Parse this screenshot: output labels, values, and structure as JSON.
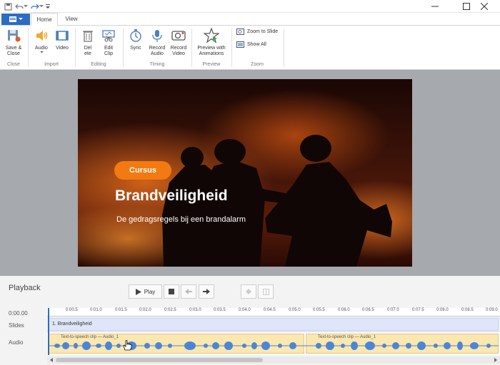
{
  "titlebar": {
    "icons": [
      "save-icon",
      "undo-icon",
      "redo-icon",
      "customize-icon"
    ],
    "controls": [
      "minimize-icon",
      "maximize-icon",
      "close-icon"
    ]
  },
  "ribbon": {
    "tabs": [
      {
        "label": "Home",
        "active": true
      },
      {
        "label": "View",
        "active": false
      }
    ],
    "groups": [
      {
        "label": "Close",
        "buttons": [
          {
            "line1": "Save &",
            "line2": "Close",
            "icon": "save-close-icon"
          }
        ]
      },
      {
        "label": "Import",
        "buttons": [
          {
            "line1": "Audio",
            "line2": "",
            "icon": "audio-icon"
          },
          {
            "line1": "Video",
            "line2": "",
            "icon": "video-icon"
          }
        ]
      },
      {
        "label": "Editing",
        "buttons": [
          {
            "line1": "Del",
            "line2": "ete",
            "icon": "delete-icon"
          },
          {
            "line1": "Edit",
            "line2": "Clip",
            "icon": "edit-clip-icon"
          }
        ]
      },
      {
        "label": "Timing",
        "buttons": [
          {
            "line1": "Sync",
            "line2": "",
            "icon": "sync-icon"
          },
          {
            "line1": "Record",
            "line2": "Audio",
            "icon": "microphone-icon"
          },
          {
            "line1": "Record",
            "line2": "Video",
            "icon": "webcam-icon"
          }
        ]
      },
      {
        "label": "Preview",
        "buttons": [
          {
            "line1": "Preview with",
            "line2": "Animations",
            "icon": "preview-star-icon"
          }
        ]
      },
      {
        "label": "Zoom",
        "buttons": [
          {
            "line1": "Zoom to Slide",
            "icon": "zoom-to-slide-icon"
          },
          {
            "line1": "Show All",
            "icon": "show-all-icon"
          }
        ]
      }
    ]
  },
  "slide": {
    "badge": "Cursus",
    "title": "Brandveiligheid",
    "subtitle": "De gedragsregels bij een brandalarm",
    "accent_color": "#f27a11"
  },
  "playback": {
    "title": "Playback",
    "play_label": "Play",
    "time": "0:00.00",
    "row_slides": "Slides",
    "row_audio": "Audio",
    "ruler_ticks": [
      "0:00.5",
      "0:01.0",
      "0:01.5",
      "0:02.0",
      "0:02.5",
      "0:03.0",
      "0:03.5",
      "0:04.0",
      "0:04.5",
      "0:05.0",
      "0:05.5",
      "0:06.0",
      "0:06.5",
      "0:07.0",
      "0:07.5",
      "0:08.0",
      "0:08.5",
      "0:09.0"
    ],
    "slide_clip": "1.  Brandveiligheid",
    "audio_clips": [
      "Text-to-speech clip — Audio_1",
      "Text-to-speech clip — Audio_1"
    ]
  }
}
